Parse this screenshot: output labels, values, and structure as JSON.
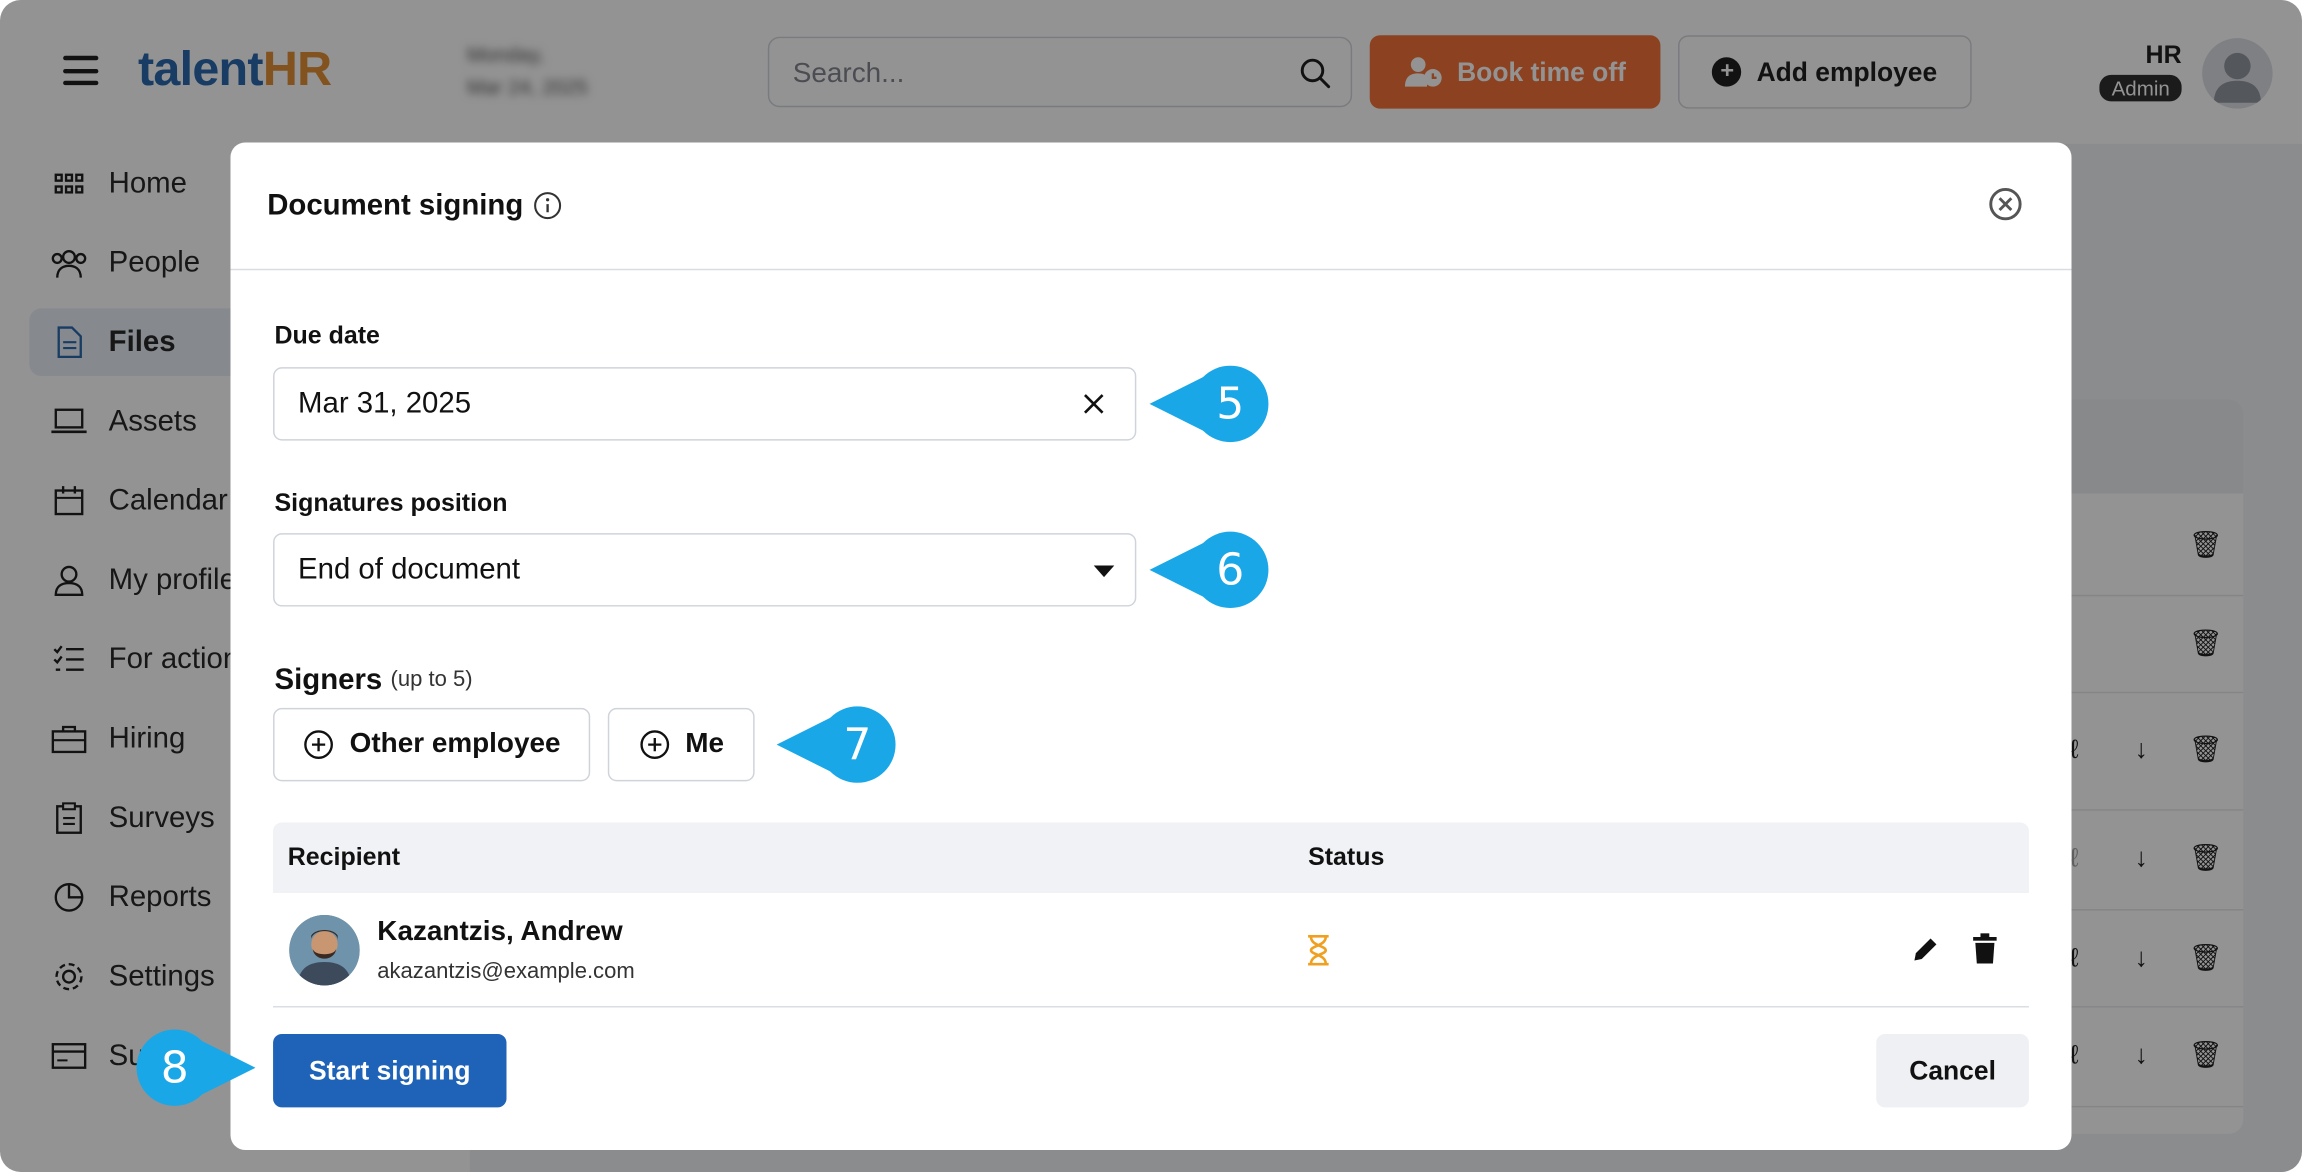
{
  "header": {
    "logo_talent": "talent",
    "logo_hr": "HR",
    "date_line1": "Monday,",
    "date_line2": "Mar 24, 2025",
    "search_placeholder": "Search...",
    "book_time_off": "Book time off",
    "add_employee": "Add employee",
    "user_initials": "HR",
    "user_role": "Admin"
  },
  "sidebar": {
    "items": [
      {
        "label": "Home",
        "icon": "grid-icon"
      },
      {
        "label": "People",
        "icon": "people-icon"
      },
      {
        "label": "Files",
        "icon": "file-icon",
        "active": true
      },
      {
        "label": "Assets",
        "icon": "laptop-icon"
      },
      {
        "label": "Calendar",
        "icon": "calendar-icon"
      },
      {
        "label": "My profile",
        "icon": "user-icon"
      },
      {
        "label": "For action",
        "icon": "checklist-icon"
      },
      {
        "label": "Hiring",
        "icon": "briefcase-icon"
      },
      {
        "label": "Surveys",
        "icon": "clipboard-icon"
      },
      {
        "label": "Reports",
        "icon": "pie-chart-icon"
      },
      {
        "label": "Settings",
        "icon": "gear-icon"
      },
      {
        "label": "Su",
        "icon": "card-icon"
      }
    ]
  },
  "modal": {
    "title": "Document signing",
    "due_date_label": "Due date",
    "due_date_value": "Mar 31, 2025",
    "signatures_position_label": "Signatures position",
    "signatures_position_value": "End of document",
    "signers_label": "Signers",
    "signers_hint": "(up to 5)",
    "add_other_employee": "Other employee",
    "add_me": "Me",
    "table": {
      "col_recipient": "Recipient",
      "col_status": "Status",
      "rows": [
        {
          "name": "Kazantzis, Andrew",
          "email": "akazantzis@example.com",
          "status_icon": "hourglass-icon"
        }
      ]
    },
    "start_signing": "Start signing",
    "cancel": "Cancel"
  },
  "callouts": {
    "c5": "5",
    "c6": "6",
    "c7": "7",
    "c8": "8"
  },
  "colors": {
    "brand_blue": "#1d5fa8",
    "brand_orange": "#f26a2c",
    "primary_button": "#1e63b8",
    "callout": "#1aa7e8",
    "pending_status": "#f0a020"
  }
}
